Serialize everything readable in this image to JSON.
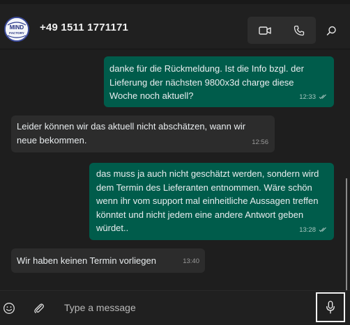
{
  "header": {
    "contact_name": "+49 1511 1771171",
    "avatar_text_line1": "MIND",
    "avatar_text_line2": "FACTORY"
  },
  "messages": [
    {
      "direction": "outgoing",
      "text": "danke für die Rückmeldung. Ist die Info bzgl. der Lieferung der nächsten 9800x3d charge diese Woche noch aktuell?",
      "time": "12:33",
      "read": true
    },
    {
      "direction": "incoming",
      "text": "Leider können wir das aktuell nicht abschätzen, wann wir neue bekommen.",
      "time": "12:56"
    },
    {
      "direction": "outgoing",
      "text": "das muss ja auch nicht geschätzt werden, sondern wird dem Termin des Lieferanten entnommen. Wäre schön wenn ihr vom support mal einheitliche Aussagen treffen könntet und nicht jedem eine andere Antwort geben würdet..",
      "time": "13:28",
      "read": true
    },
    {
      "direction": "incoming",
      "text": "Wir haben keinen Termin vorliegen",
      "time": "13:40"
    }
  ],
  "composer": {
    "placeholder": "Type a message"
  },
  "icons": {
    "video": "video-camera-icon",
    "voice": "phone-icon",
    "search": "search-icon",
    "emoji": "emoji-icon",
    "attach": "paperclip-icon",
    "mic": "microphone-icon",
    "read": "double-check-icon"
  },
  "colors": {
    "background": "#1e1e1e",
    "header": "#202020",
    "outgoing_bubble": "#005c4b",
    "incoming_bubble": "#2c2c2c",
    "text": "#e9edef"
  }
}
